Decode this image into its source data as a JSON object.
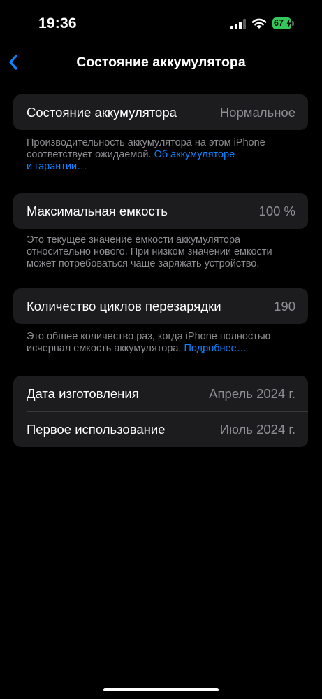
{
  "status_bar": {
    "time": "19:36",
    "battery_level": "67",
    "battery_color": "#34c759",
    "icons": [
      "cellular-signal-icon",
      "wifi-icon",
      "battery-icon",
      "charging-bolt-icon"
    ]
  },
  "nav": {
    "back_icon": "chevron-left-icon",
    "title": "Состояние аккумулятора",
    "accent_color": "#0a84ff"
  },
  "health": {
    "label": "Состояние аккумулятора",
    "value": "Нормальное",
    "footnote_line1": "Производительность аккумулятора на этом iPhone",
    "footnote_line2": "соответствует ожидаемой.",
    "footnote_link_part1": "Об аккумуляторе",
    "footnote_link_part2": "и гарантии…"
  },
  "capacity": {
    "label": "Максимальная емкость",
    "value": "100 %",
    "footnote_line1": "Это текущее значение емкости аккумулятора",
    "footnote_line2": "относительно нового. При низком значении емкости",
    "footnote_line3": "может потребоваться чаще заряжать устройство."
  },
  "cycles": {
    "label": "Количество циклов перезарядки",
    "value": "190",
    "footnote_line1": "Это общее количество раз, когда iPhone полностью",
    "footnote_line2": "исчерпал емкость аккумулятора.",
    "footnote_link": "Подробнее…"
  },
  "dates": {
    "manufacture_label": "Дата изготовления",
    "manufacture_value": "Апрель 2024 г.",
    "first_use_label": "Первое использование",
    "first_use_value": "Июль 2024 г."
  }
}
